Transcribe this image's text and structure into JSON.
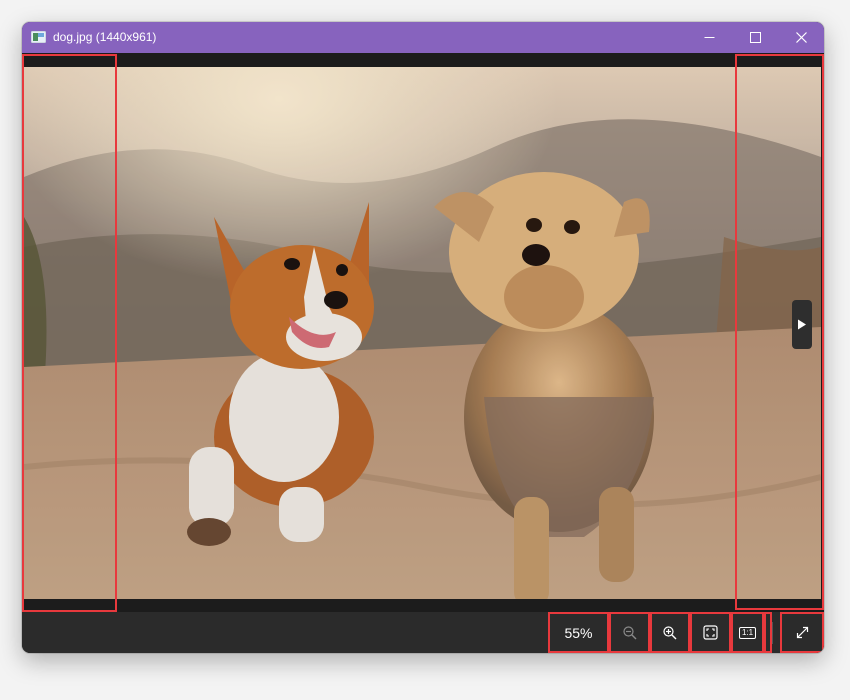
{
  "window": {
    "title": "dog.jpg (1440x961)",
    "titlebar_color": "#8763be"
  },
  "titlebar_buttons": {
    "minimize_icon": "minimize-icon",
    "maximize_icon": "maximize-icon",
    "close_icon": "close-icon"
  },
  "viewer": {
    "image_description_icon": "photo",
    "next_icon": "play-right-icon"
  },
  "toolbar": {
    "zoom_level": "55%",
    "zoom_out_icon": "zoom-out-icon",
    "zoom_in_icon": "zoom-in-icon",
    "fit_icon": "fit-to-window-icon",
    "actual_size_label": "1:1",
    "fullscreen_icon": "expand-icon"
  },
  "colors": {
    "highlight": "#e8393d",
    "toolbar_bg": "#2b2b2b",
    "viewport_bg": "#1c1c1c"
  }
}
